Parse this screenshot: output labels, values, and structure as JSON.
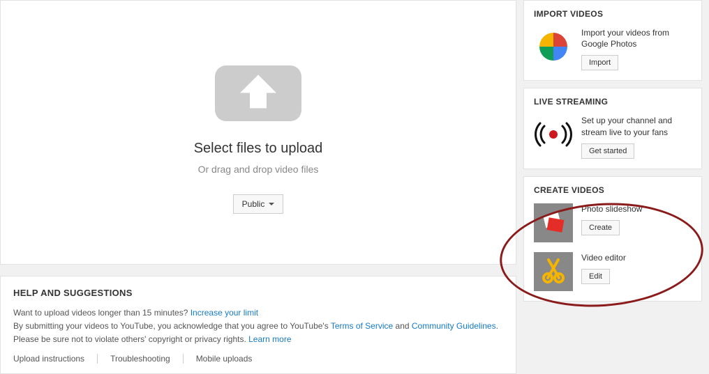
{
  "upload": {
    "title": "Select files to upload",
    "subtitle": "Or drag and drop video files",
    "privacy_label": "Public"
  },
  "help": {
    "heading": "HELP AND SUGGESTIONS",
    "line1_prefix": "Want to upload videos longer than 15 minutes? ",
    "increase_link": "Increase your limit",
    "line2_prefix": "By submitting your videos to YouTube, you acknowledge that you agree to YouTube's ",
    "tos_link": "Terms of Service",
    "and_text": " and ",
    "guidelines_link": "Community Guidelines",
    "period": ".",
    "line3_prefix": "Please be sure not to violate others' copyright or privacy rights. ",
    "learn_more": "Learn more",
    "links": {
      "instructions": "Upload instructions",
      "troubleshooting": "Troubleshooting",
      "mobile": "Mobile uploads"
    }
  },
  "sidebar": {
    "import": {
      "heading": "IMPORT VIDEOS",
      "text": "Import your videos from Google Photos",
      "button": "Import"
    },
    "live": {
      "heading": "LIVE STREAMING",
      "text": "Set up your channel and stream live to your fans",
      "button": "Get started"
    },
    "create": {
      "heading": "CREATE VIDEOS",
      "slideshow_label": "Photo slideshow",
      "slideshow_button": "Create",
      "editor_label": "Video editor",
      "editor_button": "Edit"
    }
  }
}
